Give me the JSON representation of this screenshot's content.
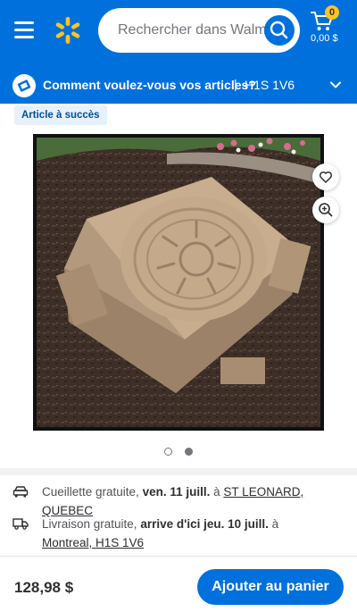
{
  "header": {
    "menu_icon": "hamburger-menu-icon",
    "logo_icon": "walmart-spark-icon",
    "search_placeholder": "Rechercher dans Walmart",
    "search_icon": "search-icon",
    "cart": {
      "icon": "cart-icon",
      "count": "0",
      "total": "0,00 $"
    },
    "brand_color": "#0071dc",
    "accent_color": "#ffc220"
  },
  "fulfillment": {
    "icon": "fulfillment-icon",
    "question": "Comment voulez-vous vos articles?",
    "separator": "|",
    "postal_code": "H1S 1V6",
    "chevron_icon": "chevron-down-icon"
  },
  "product": {
    "badge": "Article à succès",
    "image_icon": "sandbox-product-image",
    "favorite_icon": "heart-icon",
    "zoom_icon": "zoom-in-icon",
    "carousel": {
      "total": 2,
      "active": 2
    }
  },
  "shipping": {
    "pickup": {
      "icon": "car-icon",
      "label": "Cueillette gratuite,",
      "date": "ven. 11 juill.",
      "at": "à",
      "store": "ST LEONARD, QUEBEC"
    },
    "delivery": {
      "icon": "truck-icon",
      "label": "Livraison gratuite,",
      "date": "arrive d'ici jeu. 10 juill.",
      "at": "à",
      "location": "Montreal, H1S 1V6"
    }
  },
  "bottom_bar": {
    "price": "128,98 $",
    "add_to_cart": "Ajouter au panier"
  }
}
